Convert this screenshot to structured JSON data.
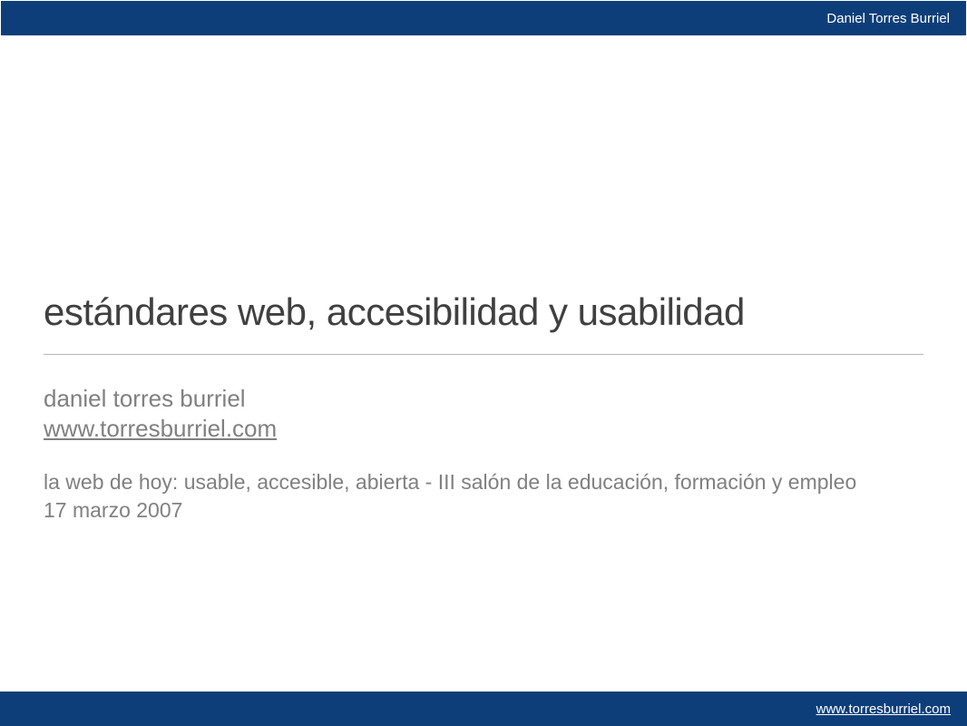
{
  "header": {
    "author": "Daniel Torres Burriel"
  },
  "main": {
    "title": "estándares web, accesibilidad y usabilidad",
    "author_name": "daniel torres burriel",
    "author_url": "www.torresburriel.com",
    "event_description": "la web de hoy: usable, accesible, abierta - III salón de la educación, formación y empleo",
    "event_date": "17 marzo 2007"
  },
  "footer": {
    "url": "www.torresburriel.com"
  }
}
